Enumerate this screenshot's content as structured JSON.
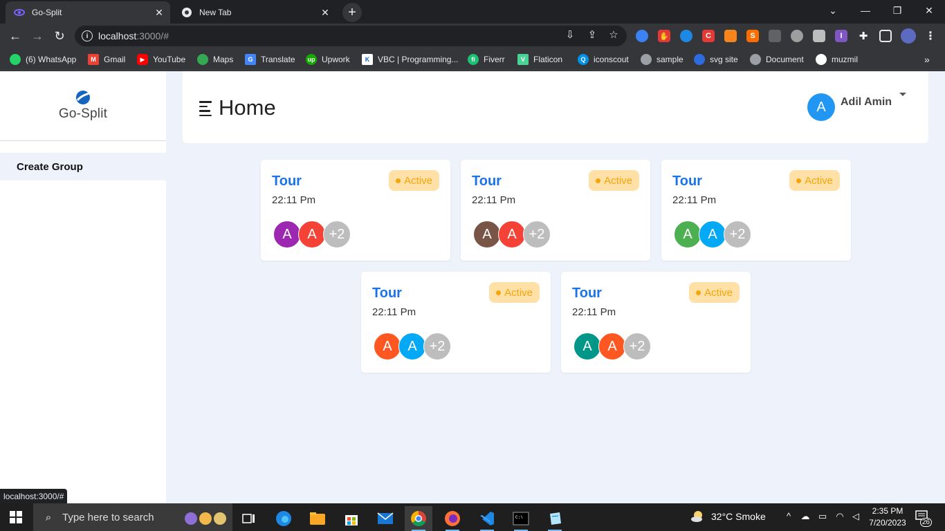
{
  "browser": {
    "tabs": [
      {
        "title": "Go-Split",
        "icon": "go-split-favicon",
        "active": true
      },
      {
        "title": "New Tab",
        "icon": "chrome-icon",
        "active": false
      }
    ],
    "url_host": "localhost",
    "url_path": ":3000/#",
    "bookmarks": [
      {
        "label": "(6) WhatsApp",
        "icon": "whatsapp-icon",
        "color": "#25d366"
      },
      {
        "label": "Gmail",
        "icon": "gmail-icon",
        "color": "#ea4335"
      },
      {
        "label": "YouTube",
        "icon": "youtube-icon",
        "color": "#ff0000"
      },
      {
        "label": "Maps",
        "icon": "maps-icon",
        "color": "#34a853"
      },
      {
        "label": "Translate",
        "icon": "translate-icon",
        "color": "#4285f4"
      },
      {
        "label": "Upwork",
        "icon": "upwork-icon",
        "color": "#14a800"
      },
      {
        "label": "VBC | Programming...",
        "icon": "vbc-icon",
        "color": "#ffffff"
      },
      {
        "label": "Fiverr",
        "icon": "fiverr-icon",
        "color": "#1dbf73"
      },
      {
        "label": "Flaticon",
        "icon": "flaticon-icon",
        "color": "#4ad295"
      },
      {
        "label": "iconscout",
        "icon": "iconscout-icon",
        "color": "#0092e4"
      },
      {
        "label": "sample",
        "icon": "globe-icon",
        "color": "#9aa0a6"
      },
      {
        "label": "svg site",
        "icon": "svg-site-icon",
        "color": "#2d6cdf"
      },
      {
        "label": "Document",
        "icon": "globe-icon",
        "color": "#9aa0a6"
      },
      {
        "label": "muzmil",
        "icon": "github-icon",
        "color": "#ffffff"
      }
    ],
    "status_url": "localhost:3000/#"
  },
  "sidebar": {
    "logo_text": "Go-Split",
    "items": [
      {
        "label": "Create Group"
      }
    ]
  },
  "header": {
    "title": "Home",
    "user": {
      "initial": "A",
      "name": "Adil Amin",
      "avatar_color": "#2196f3"
    }
  },
  "groups": [
    {
      "title": "Tour",
      "time": "22:11 Pm",
      "status": "Active",
      "members": [
        {
          "initial": "A",
          "color": "#9c27b0"
        },
        {
          "initial": "A",
          "color": "#f44336"
        }
      ],
      "more": "+2"
    },
    {
      "title": "Tour",
      "time": "22:11 Pm",
      "status": "Active",
      "members": [
        {
          "initial": "A",
          "color": "#795548"
        },
        {
          "initial": "A",
          "color": "#f44336"
        }
      ],
      "more": "+2"
    },
    {
      "title": "Tour",
      "time": "22:11 Pm",
      "status": "Active",
      "members": [
        {
          "initial": "A",
          "color": "#4caf50"
        },
        {
          "initial": "A",
          "color": "#03a9f4"
        }
      ],
      "more": "+2"
    },
    {
      "title": "Tour",
      "time": "22:11 Pm",
      "status": "Active",
      "members": [
        {
          "initial": "A",
          "color": "#ff5722"
        },
        {
          "initial": "A",
          "color": "#03a9f4"
        }
      ],
      "more": "+2"
    },
    {
      "title": "Tour",
      "time": "22:11 Pm",
      "status": "Active",
      "members": [
        {
          "initial": "A",
          "color": "#009688"
        },
        {
          "initial": "A",
          "color": "#ff5722"
        }
      ],
      "more": "+2"
    }
  ],
  "taskbar": {
    "search_placeholder": "Type here to search",
    "weather": "32°C  Smoke",
    "time": "2:35 PM",
    "date": "7/20/2023",
    "notifications": "26"
  },
  "colors": {
    "accent": "#1a73e8",
    "badge_bg": "#ffe0a6",
    "badge_fg": "#f5a50a",
    "app_bg": "#eef2fa"
  }
}
